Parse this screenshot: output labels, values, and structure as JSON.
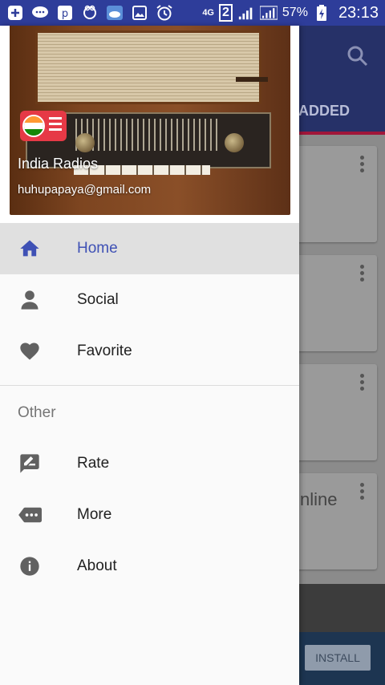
{
  "status_bar": {
    "battery": "57%",
    "network": "4G",
    "sim": "2",
    "time": "23:13",
    "icons": [
      "add-icon",
      "chat-icon",
      "message-icon",
      "baby-icon",
      "cloud-icon",
      "gallery-icon",
      "alarm-icon"
    ]
  },
  "background": {
    "tab_label": "ADDED",
    "card_text": "nline",
    "install_label": "INSTALL"
  },
  "drawer": {
    "header": {
      "app_name": "India Radios",
      "email": "huhupapaya@gmail.com"
    },
    "items": [
      {
        "label": "Home",
        "icon": "home-icon",
        "active": true
      },
      {
        "label": "Social",
        "icon": "person-icon",
        "active": false
      },
      {
        "label": "Favorite",
        "icon": "heart-icon",
        "active": false
      }
    ],
    "section_title": "Other",
    "other_items": [
      {
        "label": "Rate",
        "icon": "rate-icon"
      },
      {
        "label": "More",
        "icon": "more-icon"
      },
      {
        "label": "About",
        "icon": "info-icon"
      }
    ]
  },
  "colors": {
    "status_bar": "#2e3d9a",
    "accent": "#3f51b5",
    "active_row": "#e0e0e0",
    "icon": "#616161"
  }
}
